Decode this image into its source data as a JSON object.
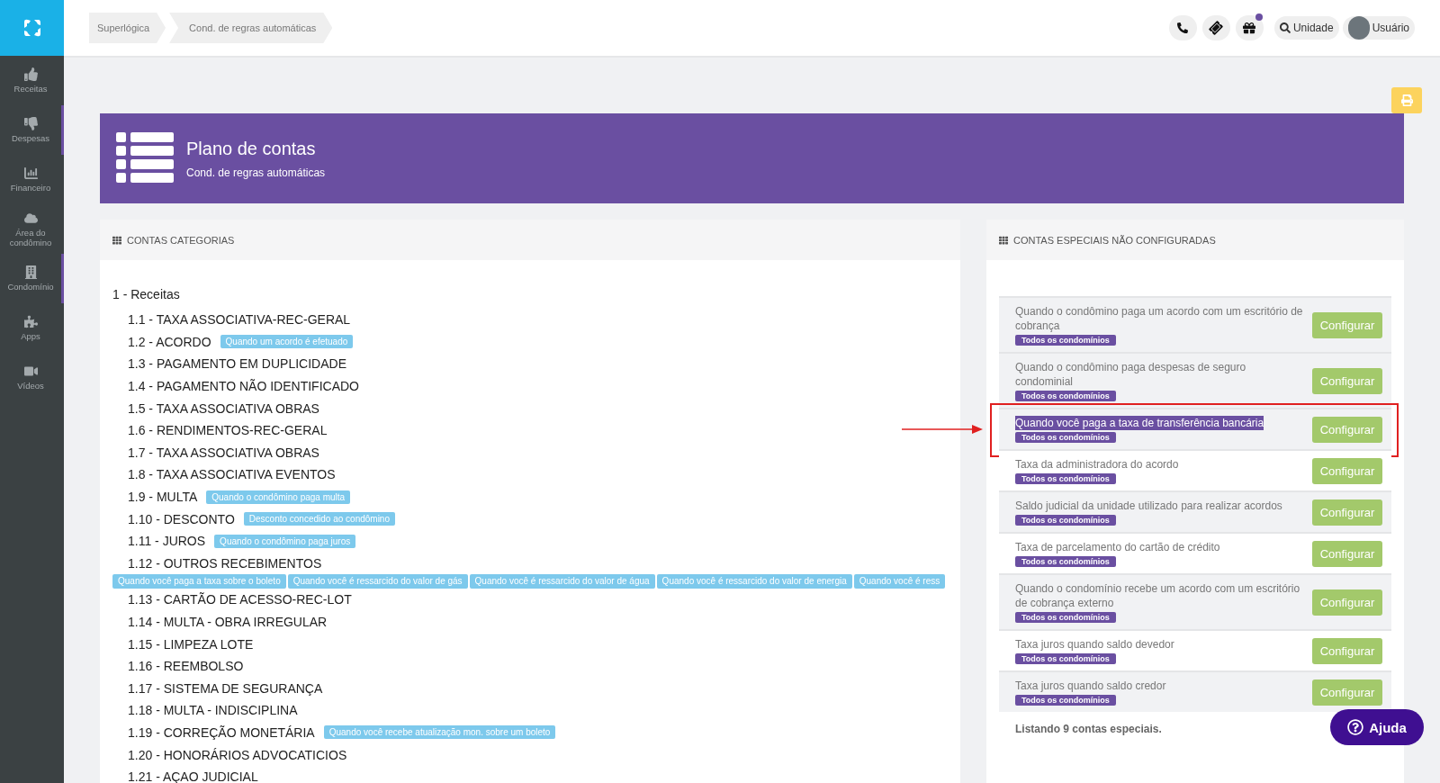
{
  "sidebar": {
    "items": [
      {
        "label": "Receitas",
        "selected": false
      },
      {
        "label": "Despesas",
        "selected": true
      },
      {
        "label": "Financeiro",
        "selected": false
      },
      {
        "label": "Área do condômino",
        "selected": false
      },
      {
        "label": "Condomínio",
        "selected": true
      },
      {
        "label": "Apps",
        "selected": false
      },
      {
        "label": "Vídeos",
        "selected": false
      }
    ]
  },
  "breadcrumbs": [
    "Superlógica",
    "Cond. de regras automáticas"
  ],
  "topbar": {
    "has_notification": true,
    "search_label": "Unidade",
    "user_label": "Usuário"
  },
  "header": {
    "title": "Plano de contas",
    "subtitle": "Cond. de regras automáticas"
  },
  "categories": {
    "title": "CONTAS CATEGORIAS",
    "group": "1 - Receitas",
    "items": [
      {
        "label": "1.1 - TAXA ASSOCIATIVA-REC-GERAL"
      },
      {
        "label": "1.2 - ACORDO",
        "tags": [
          "Quando um acordo é efetuado"
        ]
      },
      {
        "label": "1.3 - PAGAMENTO EM DUPLICIDADE"
      },
      {
        "label": "1.4 - PAGAMENTO NÃO IDENTIFICADO"
      },
      {
        "label": "1.5 - TAXA ASSOCIATIVA OBRAS"
      },
      {
        "label": "1.6 - RENDIMENTOS-REC-GERAL"
      },
      {
        "label": "1.7 - TAXA ASSOCIATIVA OBRAS"
      },
      {
        "label": "1.8 - TAXA ASSOCIATIVA EVENTOS"
      },
      {
        "label": "1.9 - MULTA",
        "tags": [
          "Quando o condômino paga multa"
        ]
      },
      {
        "label": "1.10 - DESCONTO",
        "tags": [
          "Desconto concedido ao condômino"
        ]
      },
      {
        "label": "1.11 - JUROS",
        "tags": [
          "Quando o condômino paga juros"
        ]
      },
      {
        "label": "1.12 - OUTROS RECEBIMENTOS",
        "tag_row": [
          "Quando você paga a taxa sobre o boleto",
          "Quando você é ressarcido do valor de gás",
          "Quando você é ressarcido do valor de água",
          "Quando você é ressarcido do valor de energia",
          "Quando você é ress"
        ]
      },
      {
        "label": "1.13 - CARTÃO DE ACESSO-REC-LOT"
      },
      {
        "label": "1.14 - MULTA - OBRA IRREGULAR"
      },
      {
        "label": "1.15 - LIMPEZA LOTE"
      },
      {
        "label": "1.16 - REEMBOLSO"
      },
      {
        "label": "1.17 - SISTEMA DE SEGURANÇA"
      },
      {
        "label": "1.18 - MULTA - INDISCIPLINA"
      },
      {
        "label": "1.19 - CORREÇÃO MONETÁRIA",
        "tags": [
          "Quando você recebe atualização mon. sobre um boleto"
        ]
      },
      {
        "label": "1.20 - HONORÁRIOS ADVOCATICIOS"
      },
      {
        "label": "1.21 - AÇAO JUDICIAL"
      }
    ]
  },
  "special": {
    "title": "CONTAS ESPECIAIS NÃO CONFIGURADAS",
    "rows": [
      {
        "text": "Quando o condômino paga um acordo com um escritório de cobrança",
        "badge": "Todos os condomínios",
        "button": "Configurar",
        "shaded": true,
        "highlighted": false
      },
      {
        "text": "Quando o condômino paga despesas de seguro condominial",
        "badge": "Todos os condomínios",
        "button": "Configurar",
        "shaded": true,
        "highlighted": false
      },
      {
        "text": "Quando você paga a taxa de transferência bancária",
        "badge": "Todos os condomínios",
        "button": "Configurar",
        "shaded": true,
        "highlighted": true
      },
      {
        "text": "Taxa da administradora do acordo",
        "badge": "Todos os condomínios",
        "button": "Configurar",
        "shaded": false,
        "highlighted": false
      },
      {
        "text": "Saldo judicial da unidade utilizado para realizar acordos",
        "badge": "Todos os condomínios",
        "button": "Configurar",
        "shaded": true,
        "highlighted": false
      },
      {
        "text": "Taxa de parcelamento do cartão de crédito",
        "badge": "Todos os condomínios",
        "button": "Configurar",
        "shaded": false,
        "highlighted": false
      },
      {
        "text": "Quando o condomínio recebe um acordo com um escritório de cobrança externo",
        "badge": "Todos os condomínios",
        "button": "Configurar",
        "shaded": true,
        "highlighted": false
      },
      {
        "text": "Taxa juros quando saldo devedor",
        "badge": "Todos os condomínios",
        "button": "Configurar",
        "shaded": false,
        "highlighted": false
      },
      {
        "text": "Taxa juros quando saldo credor",
        "badge": "Todos os condomínios",
        "button": "Configurar",
        "shaded": true,
        "highlighted": false
      }
    ],
    "footer": "Listando 9 contas especiais."
  },
  "help_button": "Ajuda"
}
